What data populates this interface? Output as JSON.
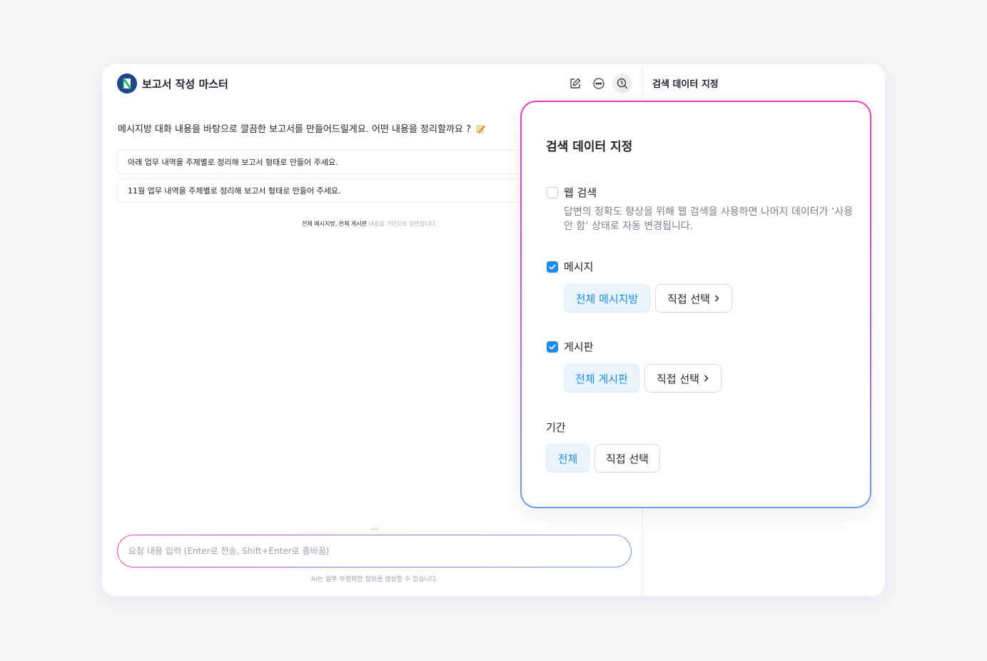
{
  "app": {
    "title": "보고서 작성 마스터"
  },
  "header": {
    "icons": [
      "edit-icon",
      "more-icon",
      "search-data-icon"
    ]
  },
  "side_panel": {
    "title": "검색 데이터 지정"
  },
  "chat": {
    "greeting": "메시지방 대화 내용을 바탕으로 깔끔한 보고서를 만들어드릴게요. 어떤 내용을 정리할까요 ?",
    "suggestions": [
      "아래 업무 내역을 주제별로 정리해 보고서 형태로 만들어 주세요.",
      "11월 업무 내역을 주제별로 정리해 보고서 형태로 만들어 주세요."
    ],
    "source_note_bold": "전체 메시지방, 전체 게시판",
    "source_note_rest": " 내용을 기반으로 답변합니다.",
    "input_placeholder": "요청 내용 입력 (Enter로 전송, Shift+Enter로 줄바꿈)",
    "input_value": "",
    "dots": "...",
    "disclaimer": "AI는 일부 부정확한 정보를 생성할 수 있습니다."
  },
  "popover": {
    "title": "검색 데이터 지정",
    "web_search": {
      "label": "웹 검색",
      "checked": false,
      "description": "답변의 정확도 향상을 위해 웹 검색을 사용하면 나머지 데이터가 ‘사용 안 함’ 상태로 자동 변경됩니다."
    },
    "message": {
      "label": "메시지",
      "checked": true,
      "option_all": "전체 메시지방",
      "option_custom": "직접 선택"
    },
    "board": {
      "label": "게시판",
      "checked": true,
      "option_all": "전체 게시판",
      "option_custom": "직접 선택"
    },
    "period": {
      "label": "기간",
      "option_all": "전체",
      "option_custom": "직접 선택"
    }
  },
  "colors": {
    "accent": "#1a8cf0",
    "selected_bg": "#eaf4fc",
    "gradient_start": "#f03cc0",
    "gradient_end": "#6f9af0"
  }
}
